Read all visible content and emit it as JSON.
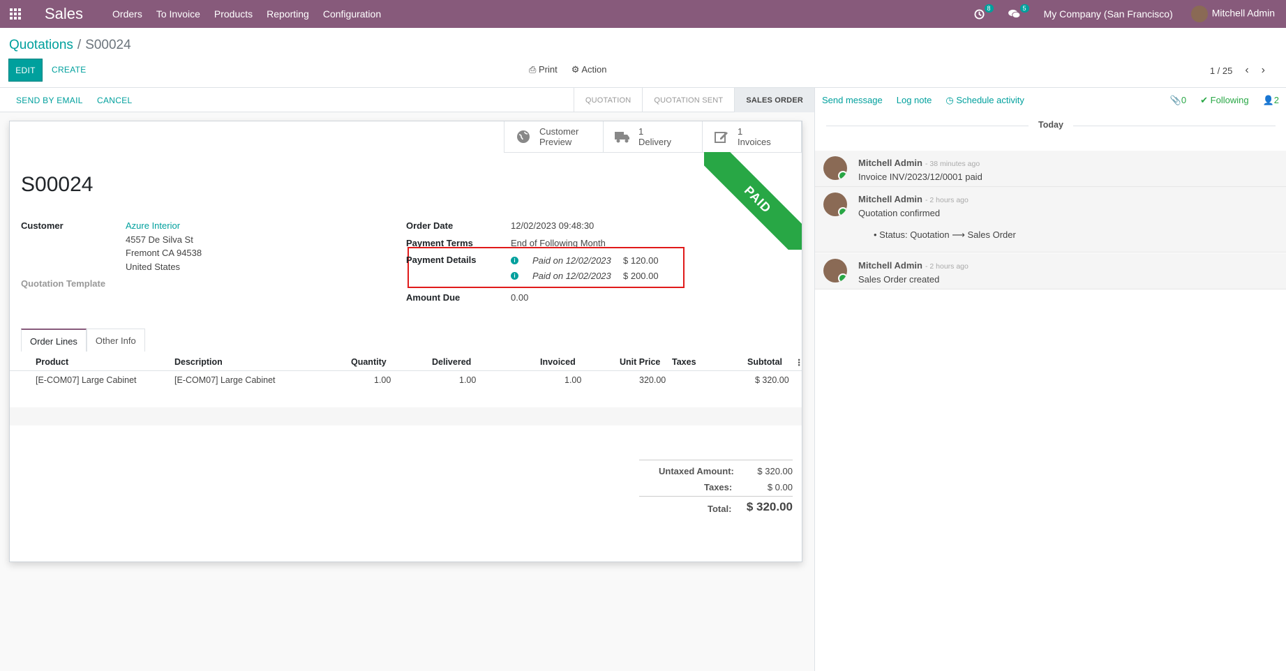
{
  "topbar": {
    "app": "Sales",
    "menu": [
      "Orders",
      "To Invoice",
      "Products",
      "Reporting",
      "Configuration"
    ],
    "activity_count": "8",
    "messages_count": "5",
    "company": "My Company (San Francisco)",
    "user": "Mitchell Admin"
  },
  "controlpanel": {
    "breadcrumb_parent": "Quotations",
    "breadcrumb_sep": "/",
    "breadcrumb_current": "S00024",
    "edit": "EDIT",
    "create": "CREATE",
    "print": "Print",
    "action": "Action",
    "pager": "1 / 25"
  },
  "statusbar": {
    "send_email": "SEND BY EMAIL",
    "cancel": "CANCEL",
    "stages": [
      "QUOTATION",
      "QUOTATION SENT",
      "SALES ORDER"
    ]
  },
  "buttons": {
    "preview": [
      "Customer",
      "Preview"
    ],
    "delivery": [
      "1",
      "Delivery"
    ],
    "invoices": [
      "1",
      "Invoices"
    ]
  },
  "ribbon": "PAID",
  "order": {
    "name": "S00024",
    "customer_label": "Customer",
    "customer_name": "Azure Interior",
    "address1": "4557 De Silva St",
    "address2": "Fremont CA 94538",
    "address3": "United States",
    "template_label": "Quotation Template",
    "order_date_label": "Order Date",
    "order_date": "12/02/2023 09:48:30",
    "payment_terms_label": "Payment Terms",
    "payment_terms": "End of Following Month",
    "payment_details_label": "Payment Details",
    "payments": [
      {
        "text": "Paid on 12/02/2023",
        "amount": "$ 120.00"
      },
      {
        "text": "Paid on 12/02/2023",
        "amount": "$ 200.00"
      }
    ],
    "amount_due_label": "Amount Due",
    "amount_due": "0.00"
  },
  "tabs": [
    "Order Lines",
    "Other Info"
  ],
  "table": {
    "headers": [
      "Product",
      "Description",
      "Quantity",
      "Delivered",
      "Invoiced",
      "Unit Price",
      "Taxes",
      "Subtotal"
    ],
    "rows": [
      [
        "[E-COM07] Large Cabinet",
        "[E-COM07] Large Cabinet",
        "1.00",
        "1.00",
        "1.00",
        "320.00",
        "",
        "$ 320.00"
      ]
    ]
  },
  "totals": {
    "untaxed_label": "Untaxed Amount:",
    "untaxed": "$ 320.00",
    "taxes_label": "Taxes:",
    "taxes": "$ 0.00",
    "total_label": "Total:",
    "total": "$ 320.00"
  },
  "chatter": {
    "send": "Send message",
    "log": "Log note",
    "schedule": "Schedule activity",
    "attachments": "0",
    "following": "Following",
    "followers": "2",
    "today": "Today",
    "messages": [
      {
        "author": "Mitchell Admin",
        "time": "- 38 minutes ago",
        "body": "Invoice INV/2023/12/0001 paid"
      },
      {
        "author": "Mitchell Admin",
        "time": "- 2 hours ago",
        "body": "Quotation confirmed",
        "detail": "Status: Quotation ⟶ Sales Order"
      },
      {
        "author": "Mitchell Admin",
        "time": "- 2 hours ago",
        "body": "Sales Order created"
      }
    ]
  }
}
